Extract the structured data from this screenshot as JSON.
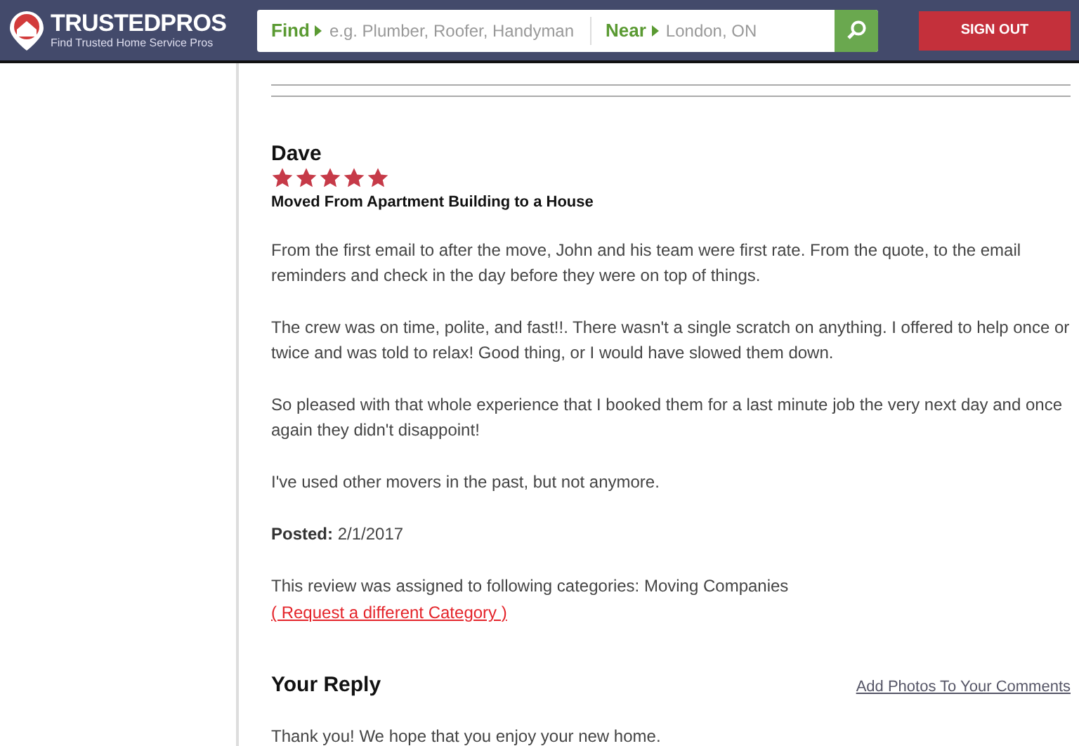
{
  "header": {
    "logo": {
      "name": "TRUSTEDPROS",
      "tagline": "Find Trusted Home Service Pros"
    },
    "search": {
      "find_label": "Find",
      "find_placeholder": "e.g. Plumber, Roofer, Handyman",
      "near_label": "Near",
      "near_value": "London, ON"
    },
    "sign_out": "SIGN OUT"
  },
  "review": {
    "author": "Dave",
    "stars": 5,
    "title": "Moved From Apartment Building to a House",
    "paragraphs": [
      "From the first email to after the move, John and his team were first rate. From the quote, to the email reminders and check in the day before they were on top of things.",
      "The crew was on time, polite, and fast!!. There wasn't a single scratch on anything. I offered to help once or twice and was told to relax! Good thing, or I would have slowed them down.",
      "So pleased with that whole experience that I booked them for a last minute job the very next day and once again they didn't disappoint!",
      "I've used other movers in the past, but not anymore."
    ],
    "posted_label": "Posted:",
    "posted_date": "2/1/2017",
    "categories": "This review was assigned to following categories: Moving Companies",
    "request_link": "( Request a different Category )"
  },
  "reply": {
    "heading": "Your Reply",
    "photos_link": "Add Photos To Your Comments",
    "text": "Thank you! We hope that you enjoy your new home."
  }
}
